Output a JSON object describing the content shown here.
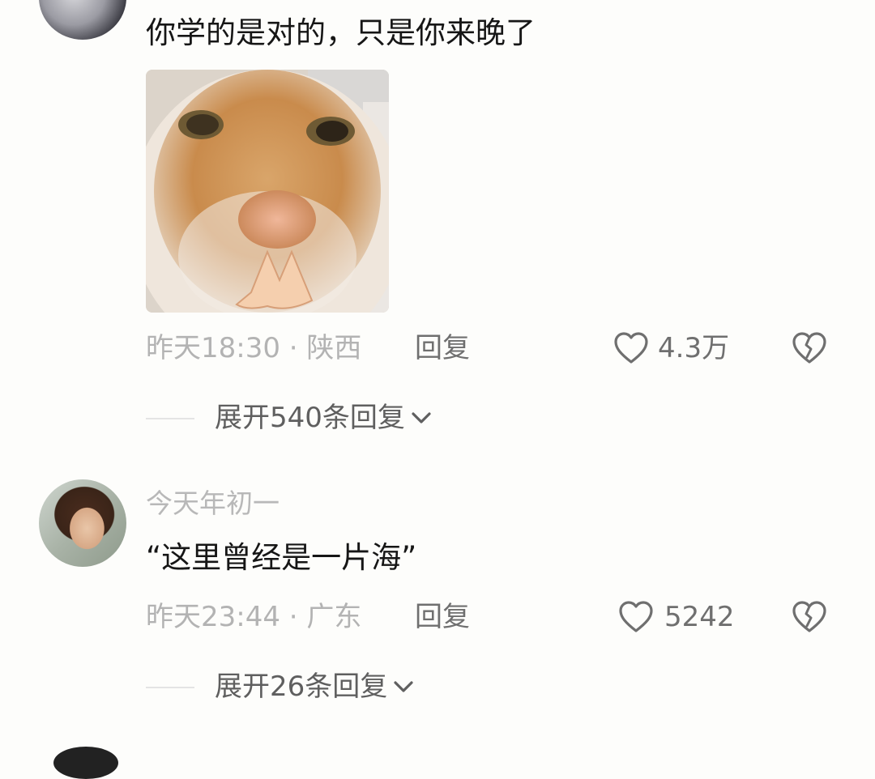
{
  "comments": [
    {
      "text": "你学的是对的，只是你来晚了",
      "meta": "昨天18:30 · 陕西",
      "reply_label": "回复",
      "likes": "4.3万",
      "expand_label": "展开540条回复",
      "avatar_icon": "user-avatar",
      "image_description_icon": "cat-photo"
    },
    {
      "username": "今天年初一",
      "text": "“这里曾经是一片海”",
      "meta": "昨天23:44 · 广东",
      "reply_label": "回复",
      "likes": "5242",
      "expand_label": "展开26条回复",
      "avatar_icon": "user-avatar"
    }
  ],
  "icons": {
    "like": "heart-outline-icon",
    "dislike": "broken-heart-icon",
    "expand": "chevron-down-icon"
  },
  "colors": {
    "background": "#fdfdfb",
    "text": "#161616",
    "meta": "#b3b3b3",
    "action": "#6f6f6f"
  }
}
